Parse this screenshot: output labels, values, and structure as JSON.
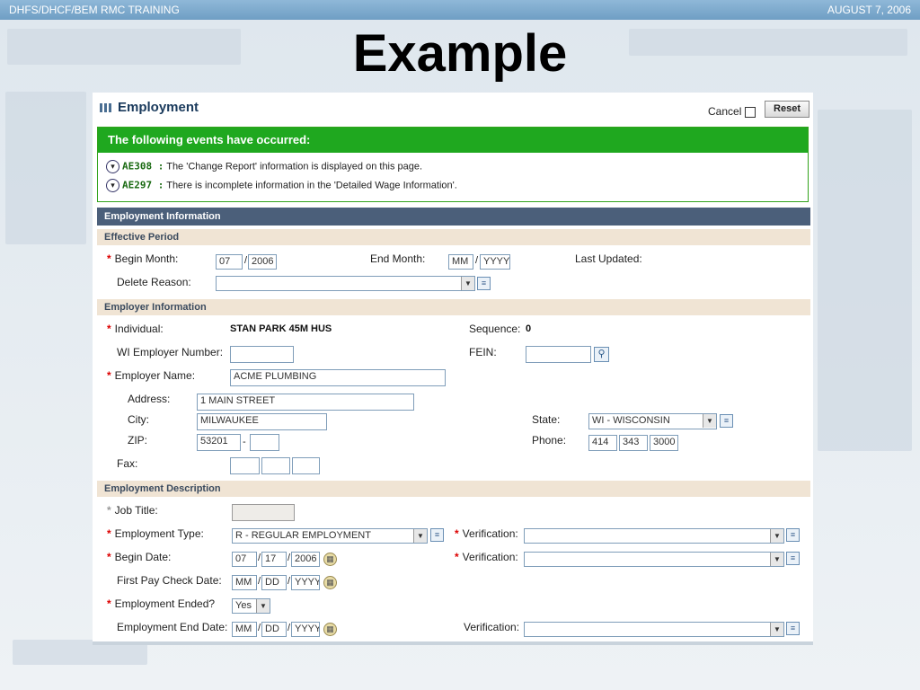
{
  "slide": {
    "header_left": "DHFS/DHCF/BEM  RMC TRAINING",
    "header_right": "AUGUST 7, 2006",
    "title": "Example"
  },
  "page": {
    "title": "Employment",
    "cancel_label": "Cancel",
    "reset_label": "Reset"
  },
  "events": {
    "heading": "The following events have occurred:",
    "items": [
      {
        "code": "AE308 :",
        "text": "The 'Change Report' information is displayed on this page."
      },
      {
        "code": "AE297 :",
        "text": "There is incomplete information in the 'Detailed Wage Information'."
      }
    ]
  },
  "employment_info": {
    "heading": "Employment Information",
    "effective_period": {
      "heading": "Effective Period",
      "begin_month_label": "Begin Month:",
      "begin_month": "07",
      "begin_year": "2006",
      "end_month_label": "End Month:",
      "end_month_placeholder": "MM",
      "end_year_placeholder": "YYYY",
      "last_updated_label": "Last Updated:",
      "delete_reason_label": "Delete Reason:",
      "delete_reason_value": ""
    },
    "employer_info": {
      "heading": "Employer Information",
      "individual_label": "Individual:",
      "individual_value": "STAN PARK 45M HUS",
      "sequence_label": "Sequence:",
      "sequence_value": "0",
      "wi_employer_label": "WI Employer Number:",
      "wi_employer_value": "",
      "fein_label": "FEIN:",
      "fein_value": "",
      "employer_name_label": "Employer Name:",
      "employer_name_value": "ACME PLUMBING",
      "address_label": "Address:",
      "address_value": "1 MAIN STREET",
      "city_label": "City:",
      "city_value": "MILWAUKEE",
      "state_label": "State:",
      "state_value": "WI - WISCONSIN",
      "zip_label": "ZIP:",
      "zip_value": "53201",
      "zip_ext_value": "",
      "phone_label": "Phone:",
      "phone_area": "414",
      "phone_prefix": "343",
      "phone_line": "3000",
      "fax_label": "Fax:"
    },
    "employment_desc": {
      "heading": "Employment Description",
      "job_title_label": "Job Title:",
      "employment_type_label": "Employment Type:",
      "employment_type_value": "R - REGULAR EMPLOYMENT",
      "verification_label": "Verification:",
      "begin_date_label": "Begin Date:",
      "begin_date_mm": "07",
      "begin_date_dd": "17",
      "begin_date_yyyy": "2006",
      "first_pay_label": "First Pay Check Date:",
      "mm_placeholder": "MM",
      "dd_placeholder": "DD",
      "yyyy_placeholder": "YYYY",
      "employment_ended_label": "Employment Ended?",
      "employment_ended_value": "Yes",
      "end_date_label": "Employment End Date:"
    }
  },
  "colors": {
    "event_green": "#1fa81f",
    "section_blue": "#4b5f7a",
    "subsection_tan": "#f0e4d4",
    "required_red": "#dd0000"
  }
}
